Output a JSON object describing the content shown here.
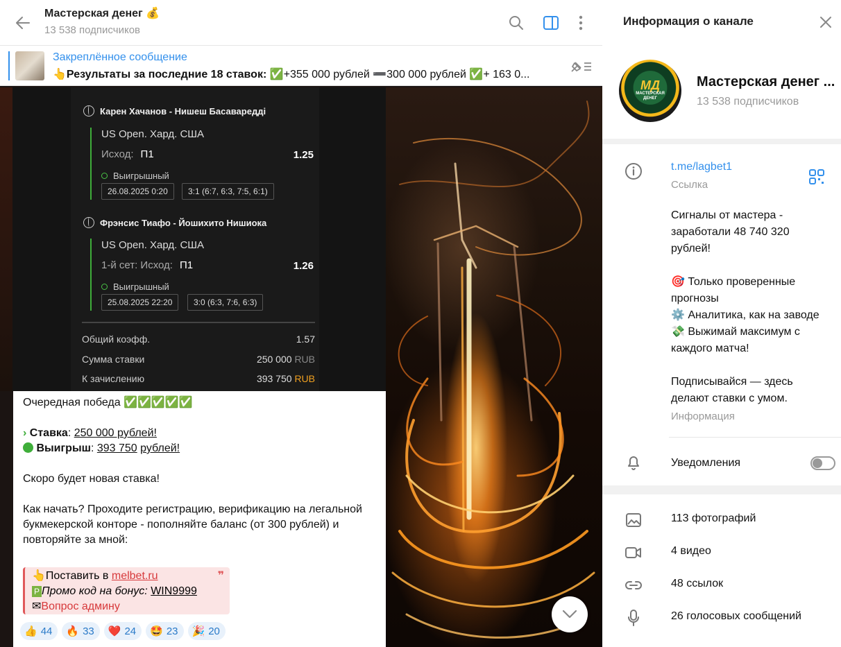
{
  "chat_header": {
    "title": "Мастерская денег 💰",
    "subtitle": "13 538 подписчиков"
  },
  "pinned": {
    "title": "Закреплённое сообщение",
    "lead": "Результаты за последние 18 ставок:",
    "rest": " ✅+355 000 рублей ➖300 000 рублей ✅+ 163 0..."
  },
  "bet_screenshot": {
    "matches": [
      {
        "teams": "Карен Хачанов - Нишеш Басавареддi",
        "tournament": "US Open. Хард. США",
        "outcome_label": "Исход:",
        "outcome_value": "П1",
        "coef": "1.25",
        "status": "Выигрышный",
        "date": "26.08.2025 0:20",
        "score": "3:1 (6:7, 6:3, 7:5, 6:1)"
      },
      {
        "teams": "Фрэнсис Тиафо - Йошихито Нишиока",
        "tournament": "US Open. Хард. США",
        "outcome_label": "1-й сет: Исход:",
        "outcome_value": "П1",
        "coef": "1.26",
        "status": "Выигрышный",
        "date": "25.08.2025 22:20",
        "score": "3:0 (6:3, 7:6, 6:3)"
      }
    ],
    "total_coef_label": "Общий коэфф.",
    "total_coef": "1.57",
    "stake_label": "Сумма ставки",
    "stake_value": "250 000",
    "payout_label": "К зачислению",
    "payout_value": "393 750",
    "currency": "RUB"
  },
  "message": {
    "line1": "Очередная победа ✅✅✅✅✅",
    "stake_icon": "›",
    "stake_label": "Ставка",
    "stake_value": "250 000 рублей!",
    "win_label": "Выигрыш",
    "win_value_1": "393 750",
    "win_value_2": "рублей!",
    "soon": "Скоро будет новая ставка!",
    "howto": "Как начать? Проходите регистрацию, верификацию на легальной букмекерской конторе - пополняйте баланс (от 300 рублей) и повторяйте за мной:",
    "quote_line1_prefix": "Поставить в ",
    "quote_line1_link": "melbet.ru",
    "quote_line2_prefix": "Промо код на бонус: ",
    "quote_line2_code": "WIN9999",
    "quote_line3": "Вопрос админу"
  },
  "reactions": [
    {
      "emoji": "👍",
      "count": "44",
      "color": "#f5c542"
    },
    {
      "emoji": "🔥",
      "count": "33",
      "color": "#f06a1a"
    },
    {
      "emoji": "❤️",
      "count": "24",
      "color": "#e8283a"
    },
    {
      "emoji": "🤩",
      "count": "23",
      "color": "#f5c542"
    },
    {
      "emoji": "🎉",
      "count": "20",
      "color": "#8a55d8"
    }
  ],
  "info_panel": {
    "title": "Информация о канале",
    "name": "Мастерская денег ...",
    "subscribers": "13 538 подписчиков",
    "avatar_text": "МД",
    "avatar_sub": "МАСТЕРСКАЯ ДЕНЕГ",
    "link": "t.me/lagbet1",
    "link_label": "Ссылка",
    "desc_1": "Сигналы от мастера - заработали 48 740 320 рублей!",
    "desc_2": "🎯 Только проверенные прогнозы",
    "desc_3": "⚙️ Аналитика, как на заводе",
    "desc_4": "💸 Выжимай максимум с каждого матча!",
    "desc_5": "Подписывайся — здесь делают ставки с умом.",
    "desc_label": "Информация",
    "notifications": "Уведомления",
    "notifications_on": false,
    "media": [
      {
        "icon": "photo-icon",
        "label": "113 фотографий"
      },
      {
        "icon": "video-icon",
        "label": "4 видео"
      },
      {
        "icon": "link-icon",
        "label": "48 ссылок"
      },
      {
        "icon": "microphone-icon",
        "label": "26 голосовых сообщений"
      }
    ]
  },
  "colors": {
    "accent": "#3390ec",
    "win_green": "#3fae3a",
    "quote_red": "#e0585a"
  }
}
